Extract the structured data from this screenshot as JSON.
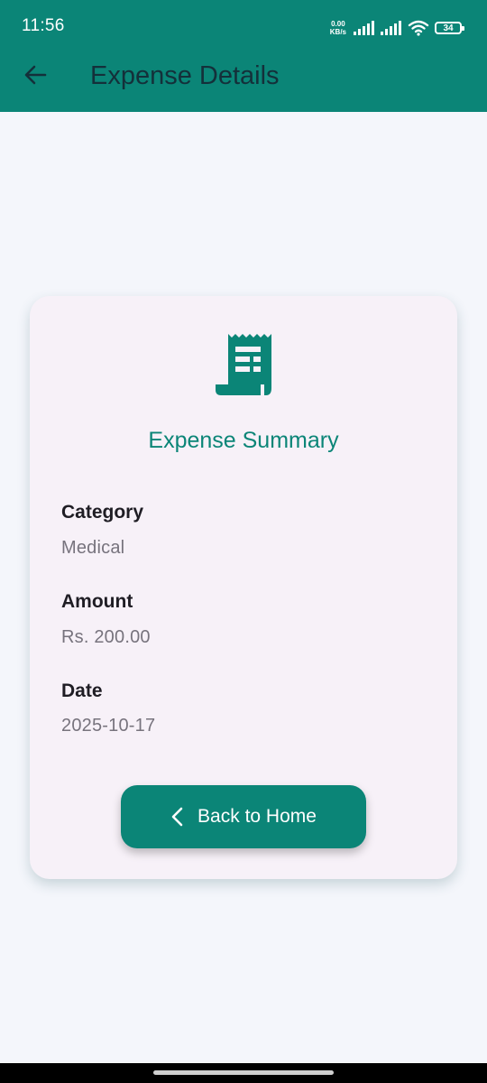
{
  "status_bar": {
    "time": "11:56",
    "net_speed_value": "0.00",
    "net_speed_unit": "KB/s",
    "battery": "34"
  },
  "app_bar": {
    "title": "Expense Details",
    "back_icon": "arrow-back-icon"
  },
  "card": {
    "icon": "receipt-icon",
    "title": "Expense Summary",
    "fields": [
      {
        "label": "Category",
        "value": "Medical"
      },
      {
        "label": "Amount",
        "value": "Rs. 200.00"
      },
      {
        "label": "Date",
        "value": "2025-10-17"
      }
    ],
    "button": {
      "icon": "chevron-left-icon",
      "label": "Back to Home"
    }
  },
  "colors": {
    "primary": "#0b8577",
    "background": "#f4f6fb",
    "card_background": "#f7f1f8",
    "title_text": "#14303a",
    "label_text": "#1f1d24",
    "value_text": "#77737d"
  }
}
